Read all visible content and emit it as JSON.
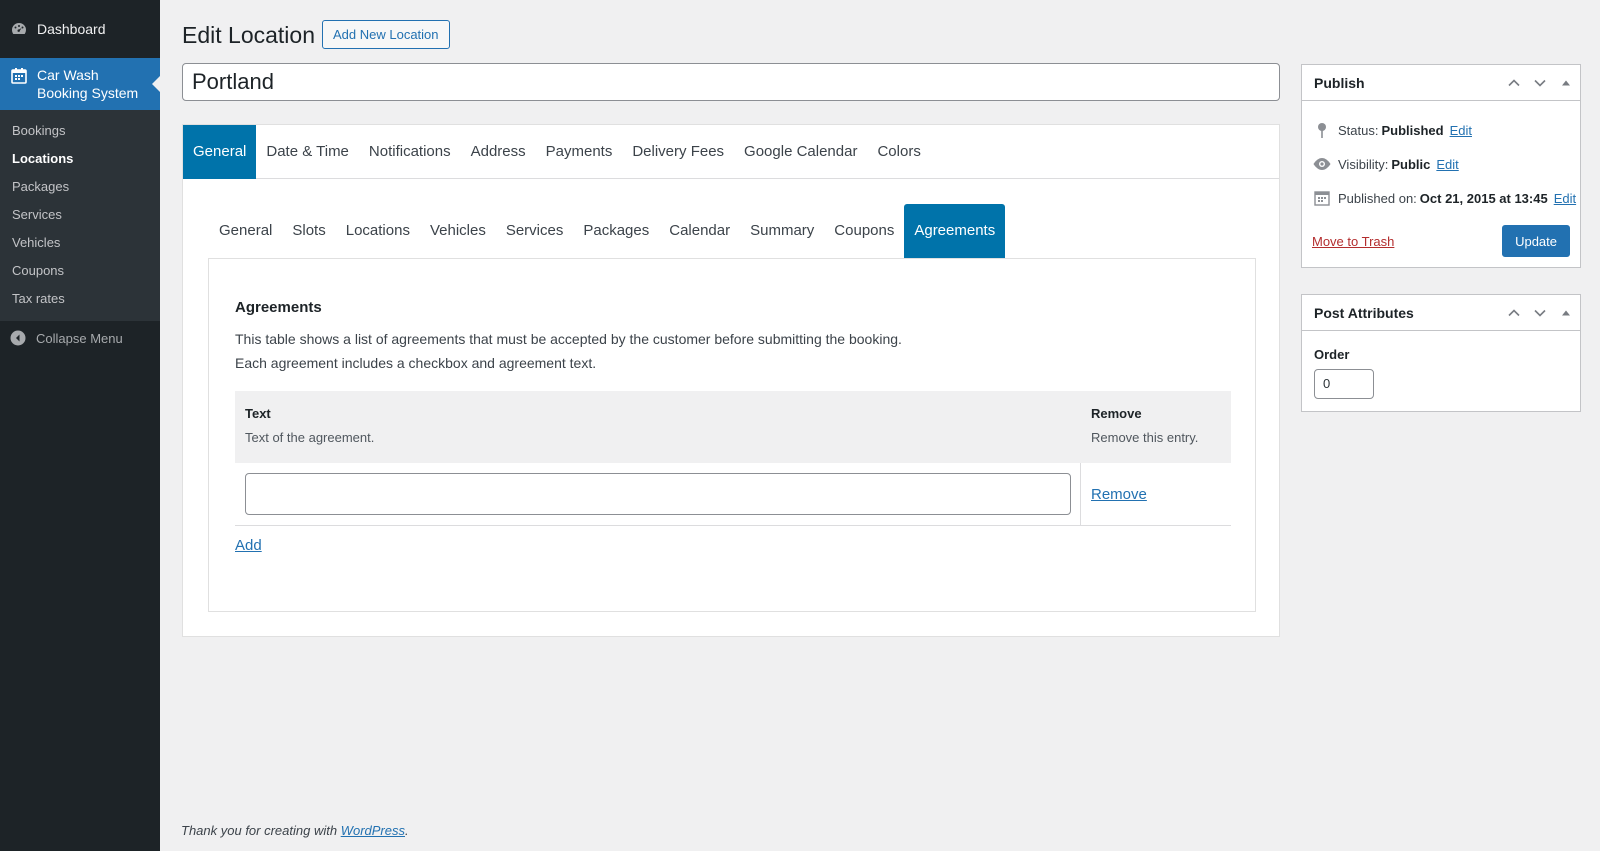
{
  "sidebar": {
    "dashboard_label": "Dashboard",
    "active_menu_label": "Car Wash Booking System",
    "items": [
      {
        "label": "Bookings"
      },
      {
        "label": "Locations"
      },
      {
        "label": "Packages"
      },
      {
        "label": "Services"
      },
      {
        "label": "Vehicles"
      },
      {
        "label": "Coupons"
      },
      {
        "label": "Tax rates"
      }
    ],
    "collapse_label": "Collapse Menu"
  },
  "header": {
    "title": "Edit Location",
    "add_new_label": "Add New Location"
  },
  "post_title": "Portland",
  "main_tabs": [
    "General",
    "Date & Time",
    "Notifications",
    "Address",
    "Payments",
    "Delivery Fees",
    "Google Calendar",
    "Colors"
  ],
  "sub_tabs": [
    "General",
    "Slots",
    "Locations",
    "Vehicles",
    "Services",
    "Packages",
    "Calendar",
    "Summary",
    "Coupons",
    "Agreements"
  ],
  "agreements": {
    "heading": "Agreements",
    "description_line1": "This table shows a list of agreements that must be accepted by the customer before submitting the booking.",
    "description_line2": "Each agreement includes a checkbox and agreement text.",
    "col_text_title": "Text",
    "col_text_sub": "Text of the agreement.",
    "col_remove_title": "Remove",
    "col_remove_sub": "Remove this entry.",
    "row_text_value": "",
    "remove_link": "Remove",
    "add_link": "Add"
  },
  "publish": {
    "title": "Publish",
    "status_label": "Status:",
    "status_value": "Published",
    "visibility_label": "Visibility:",
    "visibility_value": "Public",
    "published_label": "Published on:",
    "published_value": "Oct 21, 2015 at 13:45",
    "edit_link": "Edit",
    "trash_label": "Move to Trash",
    "update_label": "Update"
  },
  "attributes": {
    "title": "Post Attributes",
    "order_label": "Order",
    "order_value": "0"
  },
  "footer": {
    "text": "Thank you for creating with",
    "link": "WordPress",
    "suffix": "."
  },
  "colors": {
    "accent": "#2271b1",
    "tab_active": "#0073aa",
    "sidebar_bg": "#1d2327",
    "trash": "#b32d2e"
  }
}
